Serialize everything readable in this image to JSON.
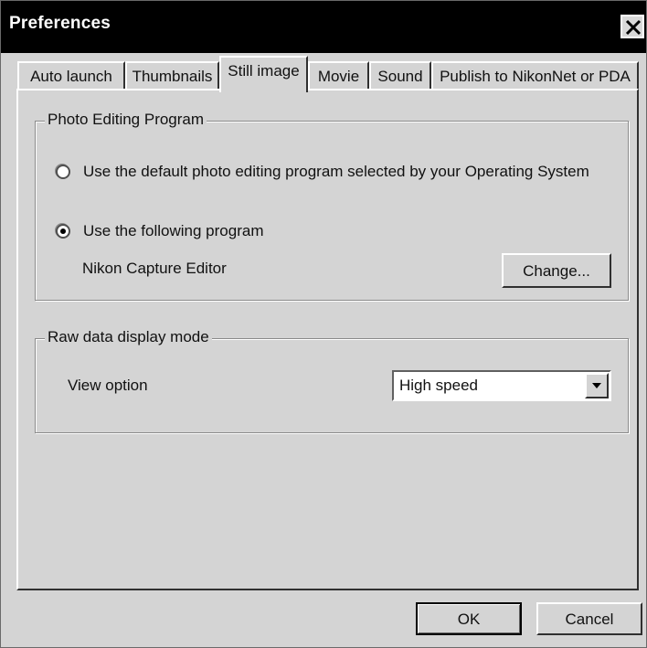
{
  "window": {
    "title": "Preferences"
  },
  "tabs": [
    {
      "label": "Auto launch",
      "active": false
    },
    {
      "label": "Thumbnails",
      "active": false
    },
    {
      "label": "Still image",
      "active": true
    },
    {
      "label": "Movie",
      "active": false
    },
    {
      "label": "Sound",
      "active": false
    },
    {
      "label": "Publish to NikonNet or PDA",
      "active": false
    }
  ],
  "photo_editing": {
    "group_title": "Photo Editing Program",
    "option_default": {
      "label": "Use the default photo editing program selected by your Operating System",
      "selected": false
    },
    "option_following": {
      "label": "Use the following program",
      "selected": true
    },
    "program_name": "Nikon Capture Editor",
    "change_label": "Change..."
  },
  "raw_display": {
    "group_title": "Raw data display mode",
    "view_option_label": "View option",
    "view_option_value": "High speed"
  },
  "footer": {
    "ok_label": "OK",
    "cancel_label": "Cancel"
  }
}
